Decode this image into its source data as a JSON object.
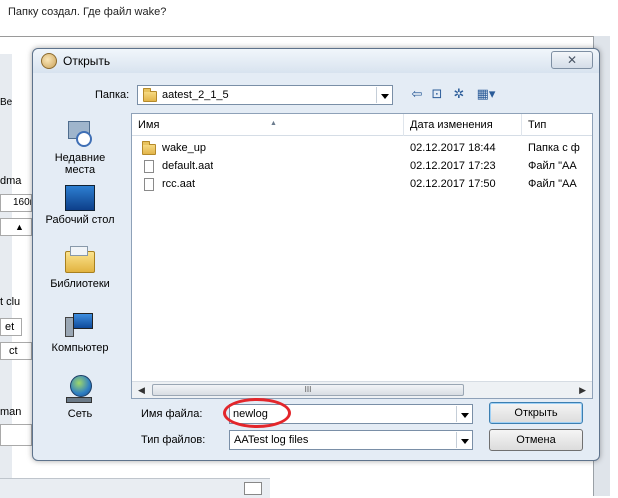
{
  "caption": "Папку создал. Где файл wake?",
  "background": {
    "labels": [
      "Ве",
      "dma",
      "160n",
      "t clu",
      "et",
      "ct",
      "man"
    ]
  },
  "dialog": {
    "title": "Открыть",
    "close_glyph": "✕",
    "folder_label": "Папка:",
    "folder_value": "aatest_2_1_5",
    "toolbar_icons": [
      "back-icon",
      "up-folder-icon",
      "new-folder-icon",
      "view-menu-icon"
    ],
    "nav": [
      {
        "label": "Недавние места",
        "icon": "recent-places-icon"
      },
      {
        "label": "Рабочий стол",
        "icon": "desktop-icon"
      },
      {
        "label": "Библиотеки",
        "icon": "libraries-icon"
      },
      {
        "label": "Компьютер",
        "icon": "computer-icon"
      },
      {
        "label": "Сеть",
        "icon": "network-icon"
      }
    ],
    "columns": {
      "name": "Имя",
      "date": "Дата изменения",
      "type": "Тип"
    },
    "files": [
      {
        "name": "wake_up",
        "date": "02.12.2017 18:44",
        "type": "Папка с ф",
        "kind": "folder"
      },
      {
        "name": "default.aat",
        "date": "02.12.2017 17:23",
        "type": "Файл \"АА",
        "kind": "file"
      },
      {
        "name": "rcc.aat",
        "date": "02.12.2017 17:50",
        "type": "Файл \"АА",
        "kind": "file"
      }
    ],
    "scroll_thumb_glyph": "III",
    "filename_label": "Имя файла:",
    "filename_value": "newlog",
    "filetype_label": "Тип файлов:",
    "filetype_value": "AATest log files",
    "open_button": "Открыть",
    "cancel_button": "Отмена"
  },
  "colors": {
    "annotation_oval": "#e3262b",
    "dialog_bg": "#e4ecf5"
  }
}
